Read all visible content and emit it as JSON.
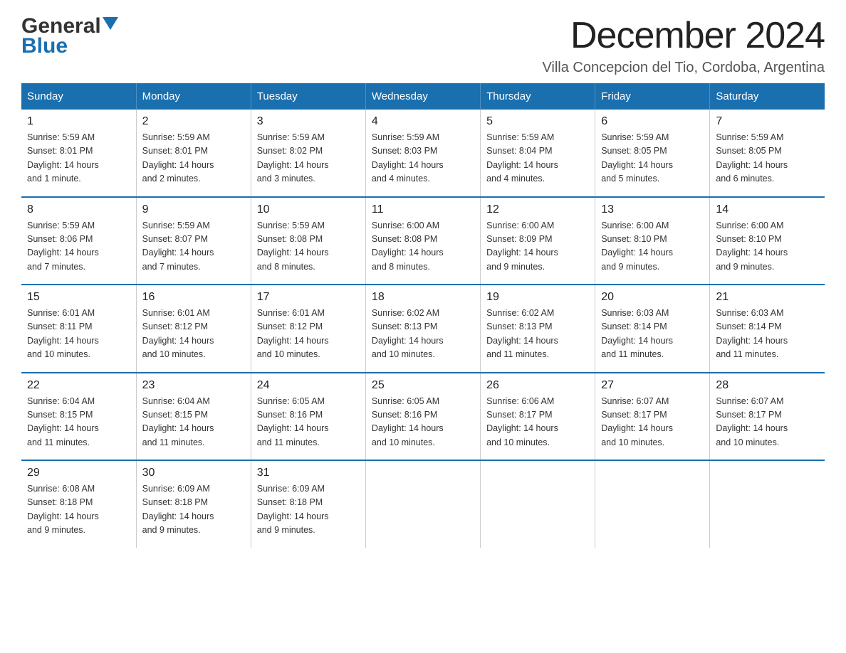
{
  "header": {
    "logo_general": "General",
    "logo_blue": "Blue",
    "main_title": "December 2024",
    "subtitle": "Villa Concepcion del Tio, Cordoba, Argentina"
  },
  "weekdays": [
    "Sunday",
    "Monday",
    "Tuesday",
    "Wednesday",
    "Thursday",
    "Friday",
    "Saturday"
  ],
  "weeks": [
    [
      {
        "day": "1",
        "sunrise": "5:59 AM",
        "sunset": "8:01 PM",
        "daylight": "14 hours and 1 minute."
      },
      {
        "day": "2",
        "sunrise": "5:59 AM",
        "sunset": "8:01 PM",
        "daylight": "14 hours and 2 minutes."
      },
      {
        "day": "3",
        "sunrise": "5:59 AM",
        "sunset": "8:02 PM",
        "daylight": "14 hours and 3 minutes."
      },
      {
        "day": "4",
        "sunrise": "5:59 AM",
        "sunset": "8:03 PM",
        "daylight": "14 hours and 4 minutes."
      },
      {
        "day": "5",
        "sunrise": "5:59 AM",
        "sunset": "8:04 PM",
        "daylight": "14 hours and 4 minutes."
      },
      {
        "day": "6",
        "sunrise": "5:59 AM",
        "sunset": "8:05 PM",
        "daylight": "14 hours and 5 minutes."
      },
      {
        "day": "7",
        "sunrise": "5:59 AM",
        "sunset": "8:05 PM",
        "daylight": "14 hours and 6 minutes."
      }
    ],
    [
      {
        "day": "8",
        "sunrise": "5:59 AM",
        "sunset": "8:06 PM",
        "daylight": "14 hours and 7 minutes."
      },
      {
        "day": "9",
        "sunrise": "5:59 AM",
        "sunset": "8:07 PM",
        "daylight": "14 hours and 7 minutes."
      },
      {
        "day": "10",
        "sunrise": "5:59 AM",
        "sunset": "8:08 PM",
        "daylight": "14 hours and 8 minutes."
      },
      {
        "day": "11",
        "sunrise": "6:00 AM",
        "sunset": "8:08 PM",
        "daylight": "14 hours and 8 minutes."
      },
      {
        "day": "12",
        "sunrise": "6:00 AM",
        "sunset": "8:09 PM",
        "daylight": "14 hours and 9 minutes."
      },
      {
        "day": "13",
        "sunrise": "6:00 AM",
        "sunset": "8:10 PM",
        "daylight": "14 hours and 9 minutes."
      },
      {
        "day": "14",
        "sunrise": "6:00 AM",
        "sunset": "8:10 PM",
        "daylight": "14 hours and 9 minutes."
      }
    ],
    [
      {
        "day": "15",
        "sunrise": "6:01 AM",
        "sunset": "8:11 PM",
        "daylight": "14 hours and 10 minutes."
      },
      {
        "day": "16",
        "sunrise": "6:01 AM",
        "sunset": "8:12 PM",
        "daylight": "14 hours and 10 minutes."
      },
      {
        "day": "17",
        "sunrise": "6:01 AM",
        "sunset": "8:12 PM",
        "daylight": "14 hours and 10 minutes."
      },
      {
        "day": "18",
        "sunrise": "6:02 AM",
        "sunset": "8:13 PM",
        "daylight": "14 hours and 10 minutes."
      },
      {
        "day": "19",
        "sunrise": "6:02 AM",
        "sunset": "8:13 PM",
        "daylight": "14 hours and 11 minutes."
      },
      {
        "day": "20",
        "sunrise": "6:03 AM",
        "sunset": "8:14 PM",
        "daylight": "14 hours and 11 minutes."
      },
      {
        "day": "21",
        "sunrise": "6:03 AM",
        "sunset": "8:14 PM",
        "daylight": "14 hours and 11 minutes."
      }
    ],
    [
      {
        "day": "22",
        "sunrise": "6:04 AM",
        "sunset": "8:15 PM",
        "daylight": "14 hours and 11 minutes."
      },
      {
        "day": "23",
        "sunrise": "6:04 AM",
        "sunset": "8:15 PM",
        "daylight": "14 hours and 11 minutes."
      },
      {
        "day": "24",
        "sunrise": "6:05 AM",
        "sunset": "8:16 PM",
        "daylight": "14 hours and 11 minutes."
      },
      {
        "day": "25",
        "sunrise": "6:05 AM",
        "sunset": "8:16 PM",
        "daylight": "14 hours and 10 minutes."
      },
      {
        "day": "26",
        "sunrise": "6:06 AM",
        "sunset": "8:17 PM",
        "daylight": "14 hours and 10 minutes."
      },
      {
        "day": "27",
        "sunrise": "6:07 AM",
        "sunset": "8:17 PM",
        "daylight": "14 hours and 10 minutes."
      },
      {
        "day": "28",
        "sunrise": "6:07 AM",
        "sunset": "8:17 PM",
        "daylight": "14 hours and 10 minutes."
      }
    ],
    [
      {
        "day": "29",
        "sunrise": "6:08 AM",
        "sunset": "8:18 PM",
        "daylight": "14 hours and 9 minutes."
      },
      {
        "day": "30",
        "sunrise": "6:09 AM",
        "sunset": "8:18 PM",
        "daylight": "14 hours and 9 minutes."
      },
      {
        "day": "31",
        "sunrise": "6:09 AM",
        "sunset": "8:18 PM",
        "daylight": "14 hours and 9 minutes."
      },
      null,
      null,
      null,
      null
    ]
  ],
  "labels": {
    "sunrise_prefix": "Sunrise: ",
    "sunset_prefix": "Sunset: ",
    "daylight_prefix": "Daylight: "
  }
}
